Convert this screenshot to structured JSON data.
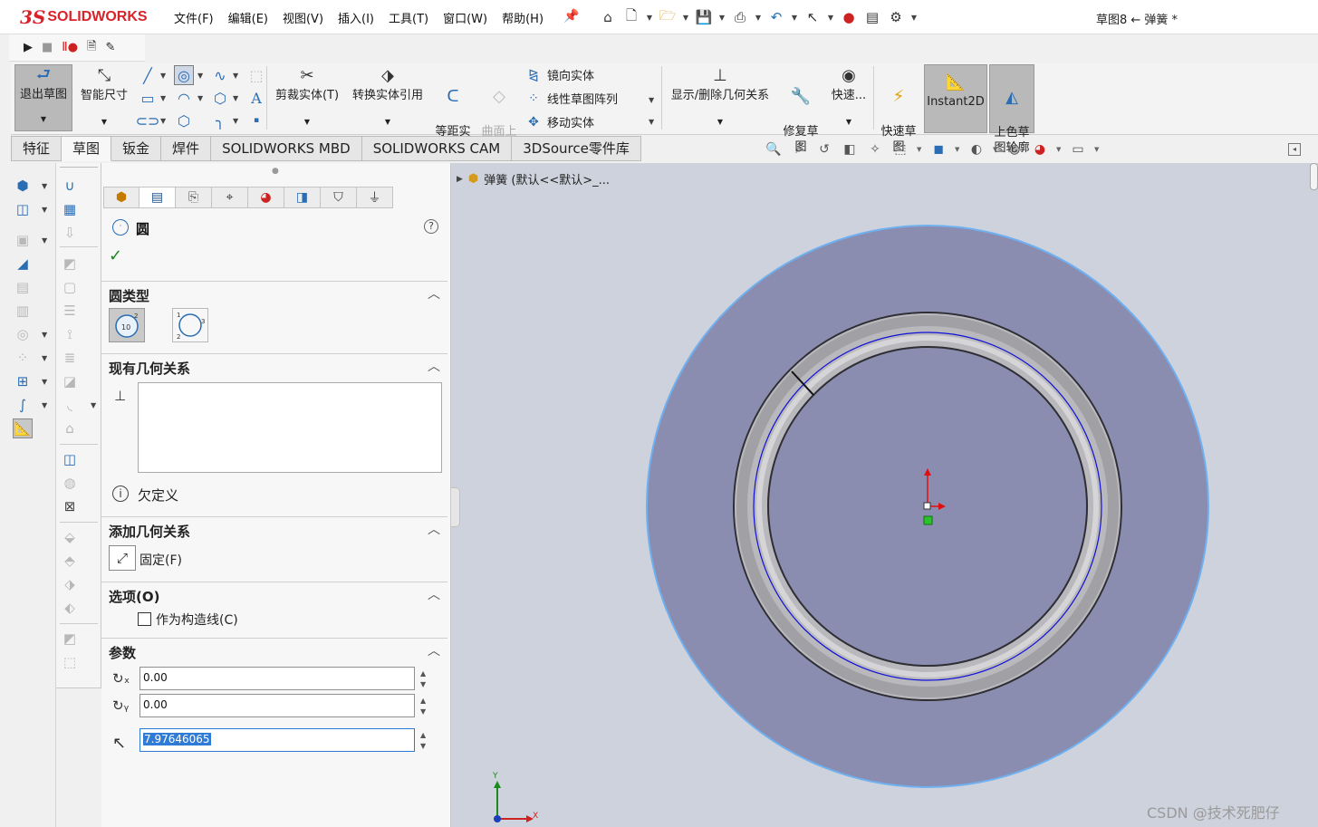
{
  "app": {
    "logo_ds": "3S",
    "logo_name": "SOLIDWORKS",
    "document_title": "草图8 ← 弹簧 *"
  },
  "menu": [
    "文件(F)",
    "编辑(E)",
    "视图(V)",
    "插入(I)",
    "工具(T)",
    "窗口(W)",
    "帮助(H)"
  ],
  "quick_access": [
    "home-icon",
    "new-document-icon",
    "open-folder-icon",
    "save-icon",
    "print-icon",
    "undo-icon",
    "select-cursor-icon",
    "traffic-light-icon",
    "file-properties-icon",
    "options-gear-icon"
  ],
  "macro_bar": [
    "play-macro-icon",
    "stop-macro-icon",
    "record-pause-icon",
    "new-macro-icon",
    "edit-macro-icon"
  ],
  "ribbon": {
    "exit_sketch": "退出草图",
    "smart_dimension": "智能尺寸",
    "trim_entities": "剪裁实体(T)",
    "convert_entities": "转换实体引用",
    "offset_entities": "等距实\n体",
    "surface_offset": "曲面上\n偏移",
    "mirror_entities": "镜向实体",
    "linear_pattern": "线性草图阵列",
    "move_entities": "移动实体",
    "display_relations": "显示/删除几何关系",
    "repair_sketch": "修复草\n图",
    "quick_snaps": "快速...",
    "rapid_sketch": "快速草\n图",
    "instant2d": "Instant2D",
    "shaded_contours": "上色草\n图轮廓"
  },
  "tabs": [
    {
      "label": "特征",
      "active": false
    },
    {
      "label": "草图",
      "active": true
    },
    {
      "label": "钣金",
      "active": false
    },
    {
      "label": "焊件",
      "active": false
    },
    {
      "label": "SOLIDWORKS MBD",
      "active": false
    },
    {
      "label": "SOLIDWORKS CAM",
      "active": false
    },
    {
      "label": "3DSource零件库",
      "active": false
    }
  ],
  "property_manager": {
    "title": "圆",
    "help": "?",
    "circle_type_header": "圆类型",
    "existing_relations_header": "现有几何关系",
    "status": "欠定义",
    "add_relations_header": "添加几何关系",
    "fix_label": "固定(F)",
    "options_header": "选项(O)",
    "construction_label": "作为构造线(C)",
    "construction_checked": false,
    "parameters_header": "参数",
    "center_x": "0.00",
    "center_y": "0.00",
    "radius": "7.97646065"
  },
  "graphics": {
    "tree_item": "弹簧  (默认<<默认>_...",
    "triad_x": "X",
    "triad_y": "Y",
    "background_color": "#ced2dc",
    "face_color": "#8a8db0",
    "face_edge_color": "#6fb0f0"
  },
  "watermark": "CSDN @技术死肥仔"
}
